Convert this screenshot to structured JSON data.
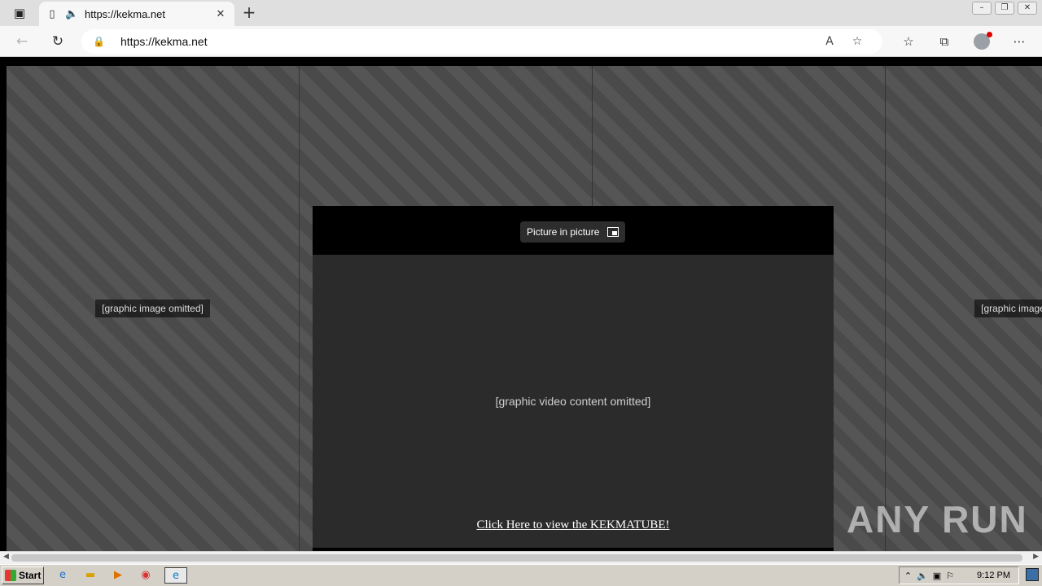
{
  "browser": {
    "tab_title": "https://kekma.net",
    "url": "https://kekma.net",
    "icons": {
      "tab_actions": "tab-actions-icon",
      "page": "page-icon",
      "audio": "speaker-icon",
      "close_tab": "close-icon",
      "new_tab": "plus-icon",
      "back": "back-arrow-icon",
      "refresh": "refresh-icon",
      "lock": "lock-icon",
      "read_aloud": "read-aloud-icon",
      "add_favorite": "star-plus-icon",
      "favorites": "favorites-icon",
      "collections": "collections-icon",
      "more": "more-icon"
    }
  },
  "page": {
    "background_placeholder": "[graphic image omitted]",
    "video": {
      "pip_label": "Picture in picture",
      "placeholder": "[graphic video content omitted]"
    },
    "link_text": "Click Here to view the KEKMATUBE!",
    "watermark": "ANY RUN"
  },
  "taskbar": {
    "start_label": "Start",
    "clock": "9:12 PM"
  }
}
